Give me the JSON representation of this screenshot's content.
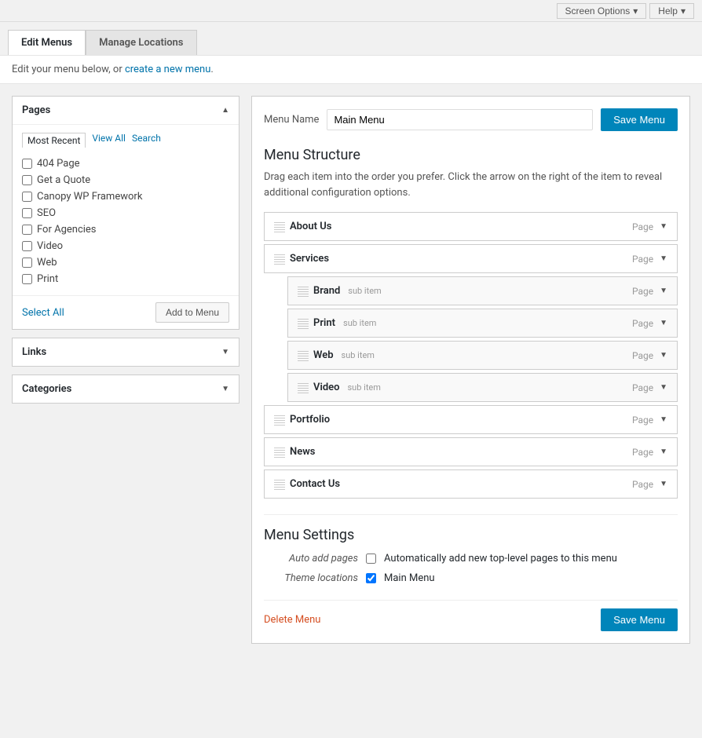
{
  "topbar": {
    "screen_options_label": "Screen Options",
    "help_label": "Help"
  },
  "tabs": [
    {
      "id": "edit-menus",
      "label": "Edit Menus",
      "active": true
    },
    {
      "id": "manage-locations",
      "label": "Manage Locations",
      "active": false
    }
  ],
  "notice": {
    "text": "Edit your menu below, or ",
    "link_text": "create a new menu",
    "suffix": "."
  },
  "pages_panel": {
    "title": "Pages",
    "tabs": [
      {
        "id": "most-recent",
        "label": "Most Recent",
        "active": true
      },
      {
        "id": "view-all",
        "label": "View All",
        "active": false
      },
      {
        "id": "search",
        "label": "Search",
        "active": false
      }
    ],
    "items": [
      {
        "id": 1,
        "label": "404 Page",
        "checked": false
      },
      {
        "id": 2,
        "label": "Get a Quote",
        "checked": false
      },
      {
        "id": 3,
        "label": "Canopy WP Framework",
        "checked": false
      },
      {
        "id": 4,
        "label": "SEO",
        "checked": false
      },
      {
        "id": 5,
        "label": "For Agencies",
        "checked": false
      },
      {
        "id": 6,
        "label": "Video",
        "checked": false
      },
      {
        "id": 7,
        "label": "Web",
        "checked": false
      },
      {
        "id": 8,
        "label": "Print",
        "checked": false
      }
    ],
    "select_all_label": "Select All",
    "add_to_menu_label": "Add to Menu"
  },
  "links_panel": {
    "title": "Links"
  },
  "categories_panel": {
    "title": "Categories"
  },
  "menu": {
    "name_label": "Menu Name",
    "name_value": "Main Menu",
    "save_label": "Save Menu",
    "structure_title": "Menu Structure",
    "structure_desc": "Drag each item into the order you prefer. Click the arrow on the right of the item to reveal additional configuration options.",
    "items": [
      {
        "id": 1,
        "label": "About Us",
        "type": "Page",
        "sub": false
      },
      {
        "id": 2,
        "label": "Services",
        "type": "Page",
        "sub": false
      },
      {
        "id": 3,
        "label": "Brand",
        "type": "Page",
        "sub": true,
        "sub_label": "sub item"
      },
      {
        "id": 4,
        "label": "Print",
        "type": "Page",
        "sub": true,
        "sub_label": "sub item"
      },
      {
        "id": 5,
        "label": "Web",
        "type": "Page",
        "sub": true,
        "sub_label": "sub item"
      },
      {
        "id": 6,
        "label": "Video",
        "type": "Page",
        "sub": true,
        "sub_label": "sub item"
      },
      {
        "id": 7,
        "label": "Portfolio",
        "type": "Page",
        "sub": false
      },
      {
        "id": 8,
        "label": "News",
        "type": "Page",
        "sub": false
      },
      {
        "id": 9,
        "label": "Contact Us",
        "type": "Page",
        "sub": false
      }
    ],
    "settings_title": "Menu Settings",
    "auto_add_label": "Auto add pages",
    "auto_add_desc": "Automatically add new top-level pages to this menu",
    "theme_locations_label": "Theme locations",
    "theme_main_menu": "Main Menu",
    "delete_label": "Delete Menu",
    "save_bottom_label": "Save Menu"
  }
}
